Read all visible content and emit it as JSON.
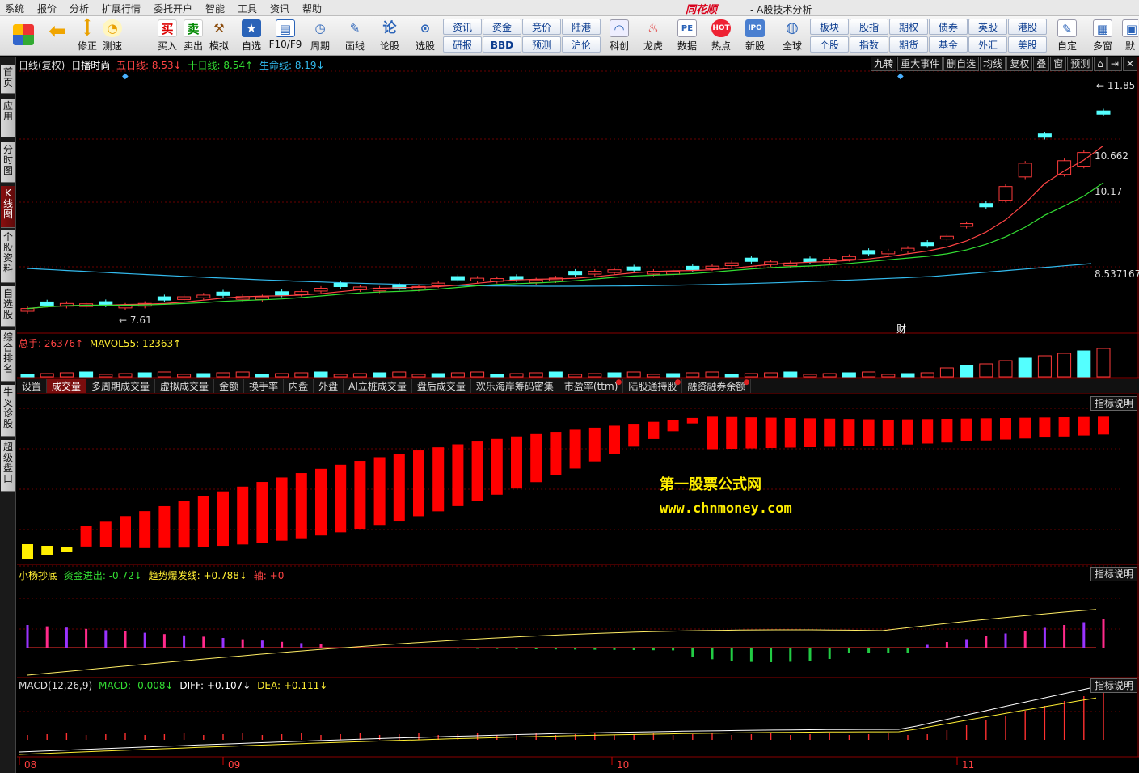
{
  "menu": [
    "系统",
    "报价",
    "分析",
    "扩展行情",
    "委托开户",
    "智能",
    "工具",
    "资讯",
    "帮助"
  ],
  "brand": "同花顺",
  "app_title": "- A股技术分析",
  "toolbar_big": [
    {
      "label": "",
      "icon": "grid-icon"
    },
    {
      "label": "",
      "icon": "back-arrow-icon"
    },
    {
      "label": "修正",
      "icon": "updown-arrows-icon"
    },
    {
      "label": "测速",
      "icon": "clock-icon"
    },
    {
      "label": "买入",
      "icon": "buy-icon",
      "glyph": "买"
    },
    {
      "label": "卖出",
      "icon": "sell-icon",
      "glyph": "卖"
    },
    {
      "label": "模拟",
      "icon": "gavel-icon"
    },
    {
      "label": "自选",
      "icon": "star-icon"
    },
    {
      "label": "F10/F9",
      "icon": "doc-icon"
    },
    {
      "label": "周期",
      "icon": "cycle-icon"
    },
    {
      "label": "画线",
      "icon": "pencil-icon"
    },
    {
      "label": "论股",
      "icon": "discuss-icon",
      "glyph": "论"
    },
    {
      "label": "选股",
      "icon": "select-stock-icon"
    },
    {
      "label": "科创",
      "icon": "sci-tech-icon"
    },
    {
      "label": "龙虎",
      "icon": "dragon-tiger-icon"
    },
    {
      "label": "数据",
      "icon": "pe-data-icon"
    },
    {
      "label": "热点",
      "icon": "hot-icon"
    },
    {
      "label": "新股",
      "icon": "ipo-icon"
    },
    {
      "label": "全球",
      "icon": "globe-icon"
    },
    {
      "label": "自定",
      "icon": "custom-icon"
    },
    {
      "label": "多窗",
      "icon": "multiwindow-icon"
    },
    {
      "label": "默",
      "icon": "default-icon"
    }
  ],
  "toolbar_small": [
    [
      "资讯",
      "研报"
    ],
    [
      "资金",
      "BBD"
    ],
    [
      "竞价",
      "预测"
    ],
    [
      "陆港",
      "沪伦"
    ],
    [
      "板块",
      "个股"
    ],
    [
      "股指",
      "指数"
    ],
    [
      "期权",
      "期货"
    ],
    [
      "债券",
      "基金"
    ],
    [
      "英股",
      "外汇"
    ],
    [
      "港股",
      "美股"
    ]
  ],
  "side_tabs": [
    {
      "label": "首页",
      "active": false
    },
    {
      "label": "应用",
      "active": false
    },
    {
      "label": "分时图",
      "active": false
    },
    {
      "label": "K线图",
      "active": true
    },
    {
      "label": "个股资料",
      "active": false
    },
    {
      "label": "自选股",
      "active": false
    },
    {
      "label": "综合排名",
      "active": false
    },
    {
      "label": "牛叉诊股",
      "active": false
    },
    {
      "label": "超级盘口",
      "active": false
    }
  ],
  "price_legend": {
    "period": "日线(复权)",
    "name": "日播时尚",
    "ma5": "五日线: 8.53↓",
    "ma10": "十日线: 8.54↑",
    "life": "生命线: 8.19↓"
  },
  "right_tabs": [
    "九转",
    "重大事件",
    "删自选",
    "均线",
    "复权",
    "叠",
    "窗",
    "预测"
  ],
  "price_labels": {
    "high": "11.85",
    "low": "7.61",
    "ma_a": "10.662",
    "ma_b": "10.17",
    "ma_c": "8.537167",
    "event": "财"
  },
  "volume_legend": {
    "total": "总手: 26376↑",
    "mavol": "MAVOL55: 12363↑"
  },
  "volume_tabs": [
    {
      "label": "设置",
      "active": false,
      "dot": false
    },
    {
      "label": "成交量",
      "active": true,
      "dot": false
    },
    {
      "label": "多周期成交量",
      "active": false,
      "dot": false
    },
    {
      "label": "虚拟成交量",
      "active": false,
      "dot": false
    },
    {
      "label": "金额",
      "active": false,
      "dot": false
    },
    {
      "label": "换手率",
      "active": false,
      "dot": false
    },
    {
      "label": "内盘",
      "active": false,
      "dot": false
    },
    {
      "label": "外盘",
      "active": false,
      "dot": false
    },
    {
      "label": "AI立桩成交量",
      "active": false,
      "dot": false
    },
    {
      "label": "盘后成交量",
      "active": false,
      "dot": false
    },
    {
      "label": "欢乐海岸筹码密集",
      "active": false,
      "dot": false
    },
    {
      "label": "市盈率(ttm)",
      "active": false,
      "dot": true
    },
    {
      "label": "陆股通持股",
      "active": false,
      "dot": true
    },
    {
      "label": "融资融券余额",
      "active": false,
      "dot": true
    }
  ],
  "indicator_btn": "指标说明",
  "watermark": {
    "line1": "第一股票公式网",
    "line2": "www.chnmoney.com"
  },
  "ind2_legend": {
    "name": "小杨抄底",
    "a": "资金进出: -0.72↓",
    "b": "趋势爆发线: +0.788↓",
    "c": "轴: +0"
  },
  "macd_legend": {
    "name": "MACD(12,26,9)",
    "macd": "MACD: -0.008↓",
    "diff": "DIFF: +0.107↓",
    "dea": "DEA: +0.111↓"
  },
  "x_axis": [
    "08",
    "09",
    "10",
    "11"
  ],
  "colors": {
    "up": "#ff3b3b",
    "down": "#54ffff",
    "ma5": "#ff4444",
    "ma10": "#33dd33",
    "life": "#33bbee",
    "grid": "#6a0000"
  }
}
